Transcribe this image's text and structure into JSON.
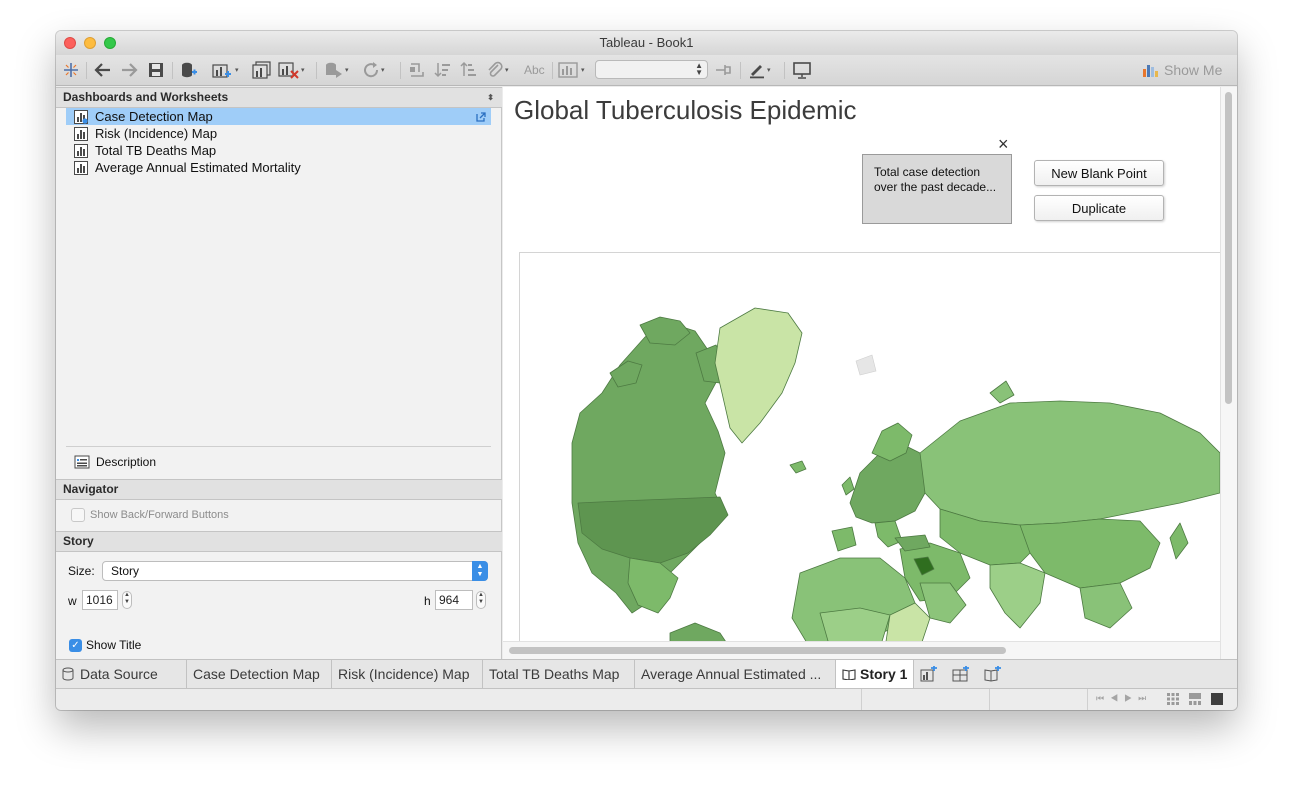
{
  "window": {
    "title": "Tableau - Book1"
  },
  "toolbar": {
    "combo_value": "",
    "abc_label": "Abc",
    "show_me_label": "Show Me",
    "icons": [
      "tableau-logo-icon",
      "back-icon",
      "forward-icon",
      "save-icon",
      "new-datasource-icon",
      "new-worksheet-icon",
      "duplicate-sheet-icon",
      "clear-sheet-icon",
      "run-update-icon",
      "refresh-icon",
      "swap-icon",
      "sort-ascending-icon",
      "sort-descending-icon",
      "group-icon",
      "label-icon",
      "fit-icon",
      "pin-icon",
      "highlight-icon",
      "presentation-icon"
    ]
  },
  "left_panel": {
    "sheets_header": "Dashboards and Worksheets",
    "sheets": [
      {
        "label": "Case Detection Map"
      },
      {
        "label": "Risk (Incidence) Map"
      },
      {
        "label": "Total TB Deaths Map"
      },
      {
        "label": "Average Annual Estimated Mortality"
      }
    ],
    "description_label": "Description",
    "navigator_header": "Navigator",
    "show_back_forward_label": "Show Back/Forward Buttons",
    "show_back_forward_checked": false,
    "story_header": "Story",
    "size_label": "Size:",
    "size_value": "Story",
    "w_label": "w",
    "w_value": "1016",
    "h_label": "h",
    "h_value": "964",
    "show_title_label": "Show Title",
    "show_title_checked": true
  },
  "story": {
    "title": "Global Tuberculosis Epidemic",
    "caption": "Total case detection over the past decade...",
    "close_symbol": "×",
    "new_blank_point_label": "New Blank Point",
    "duplicate_label": "Duplicate"
  },
  "tabs": [
    {
      "label": "Data Source"
    },
    {
      "label": "Case Detection Map"
    },
    {
      "label": "Risk (Incidence) Map"
    },
    {
      "label": "Total TB Deaths Map"
    },
    {
      "label": "Average Annual Estimated ..."
    },
    {
      "label": "Story 1"
    }
  ],
  "colors": {
    "map_dark": "#5e9550",
    "map_mid": "#7dba6a",
    "map_light": "#c9e4a6",
    "map_highlight": "#2f6e1f",
    "selection": "#9fcdf8",
    "accent": "#3a8ee6"
  }
}
